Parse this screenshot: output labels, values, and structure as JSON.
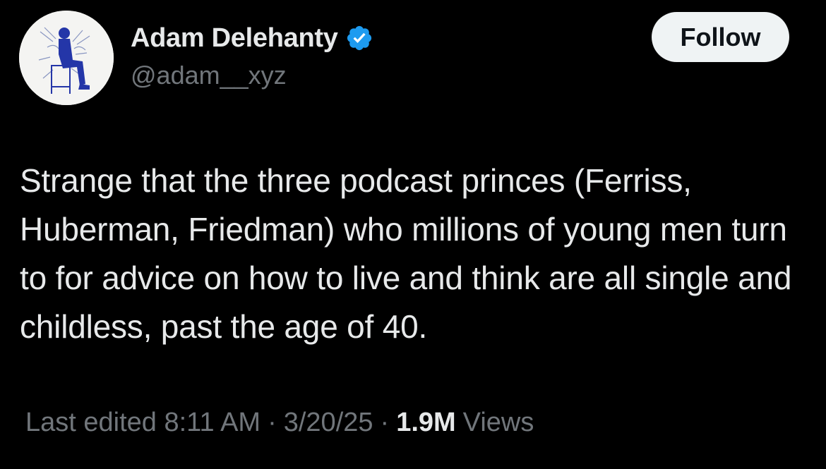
{
  "author": {
    "display_name": "Adam Delehanty",
    "handle": "@adam__xyz",
    "verified": true,
    "verified_color": "#1d9bf0",
    "avatar_icon": "avatar-illustration-icon"
  },
  "follow_button": {
    "label": "Follow"
  },
  "tweet": {
    "text": "Strange that the three podcast princes (Ferriss, Huberman, Friedman) who millions of young men turn to for advice on how to live and think are all single and childless, past the age of 40."
  },
  "meta": {
    "edited_label": "Last edited 8:11 AM",
    "separator": "·",
    "date": "3/20/25",
    "views_count": "1.9M",
    "views_label": "Views"
  },
  "colors": {
    "background": "#000000",
    "primary_text": "#e7e9ea",
    "secondary_text": "#71767b",
    "button_bg": "#eff3f4",
    "button_text": "#0f1419"
  }
}
